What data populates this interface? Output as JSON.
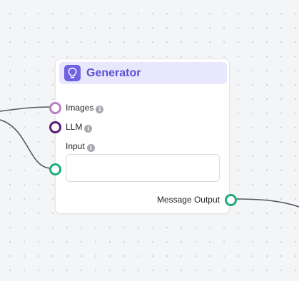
{
  "node": {
    "title": "Generator",
    "icon": "lightbulb-icon",
    "accent_color": "#6e63e3",
    "inputs": [
      {
        "label": "Images",
        "handle_color": "#b582c4"
      },
      {
        "label": "LLM",
        "handle_color": "#5b1a78"
      },
      {
        "label": "Input",
        "handle_color": "#1fab7f"
      }
    ],
    "input_field": {
      "value": "",
      "placeholder": ""
    },
    "output": {
      "label": "Message Output",
      "handle_color": "#1fab7f"
    }
  },
  "info_icon_glyph": "i"
}
